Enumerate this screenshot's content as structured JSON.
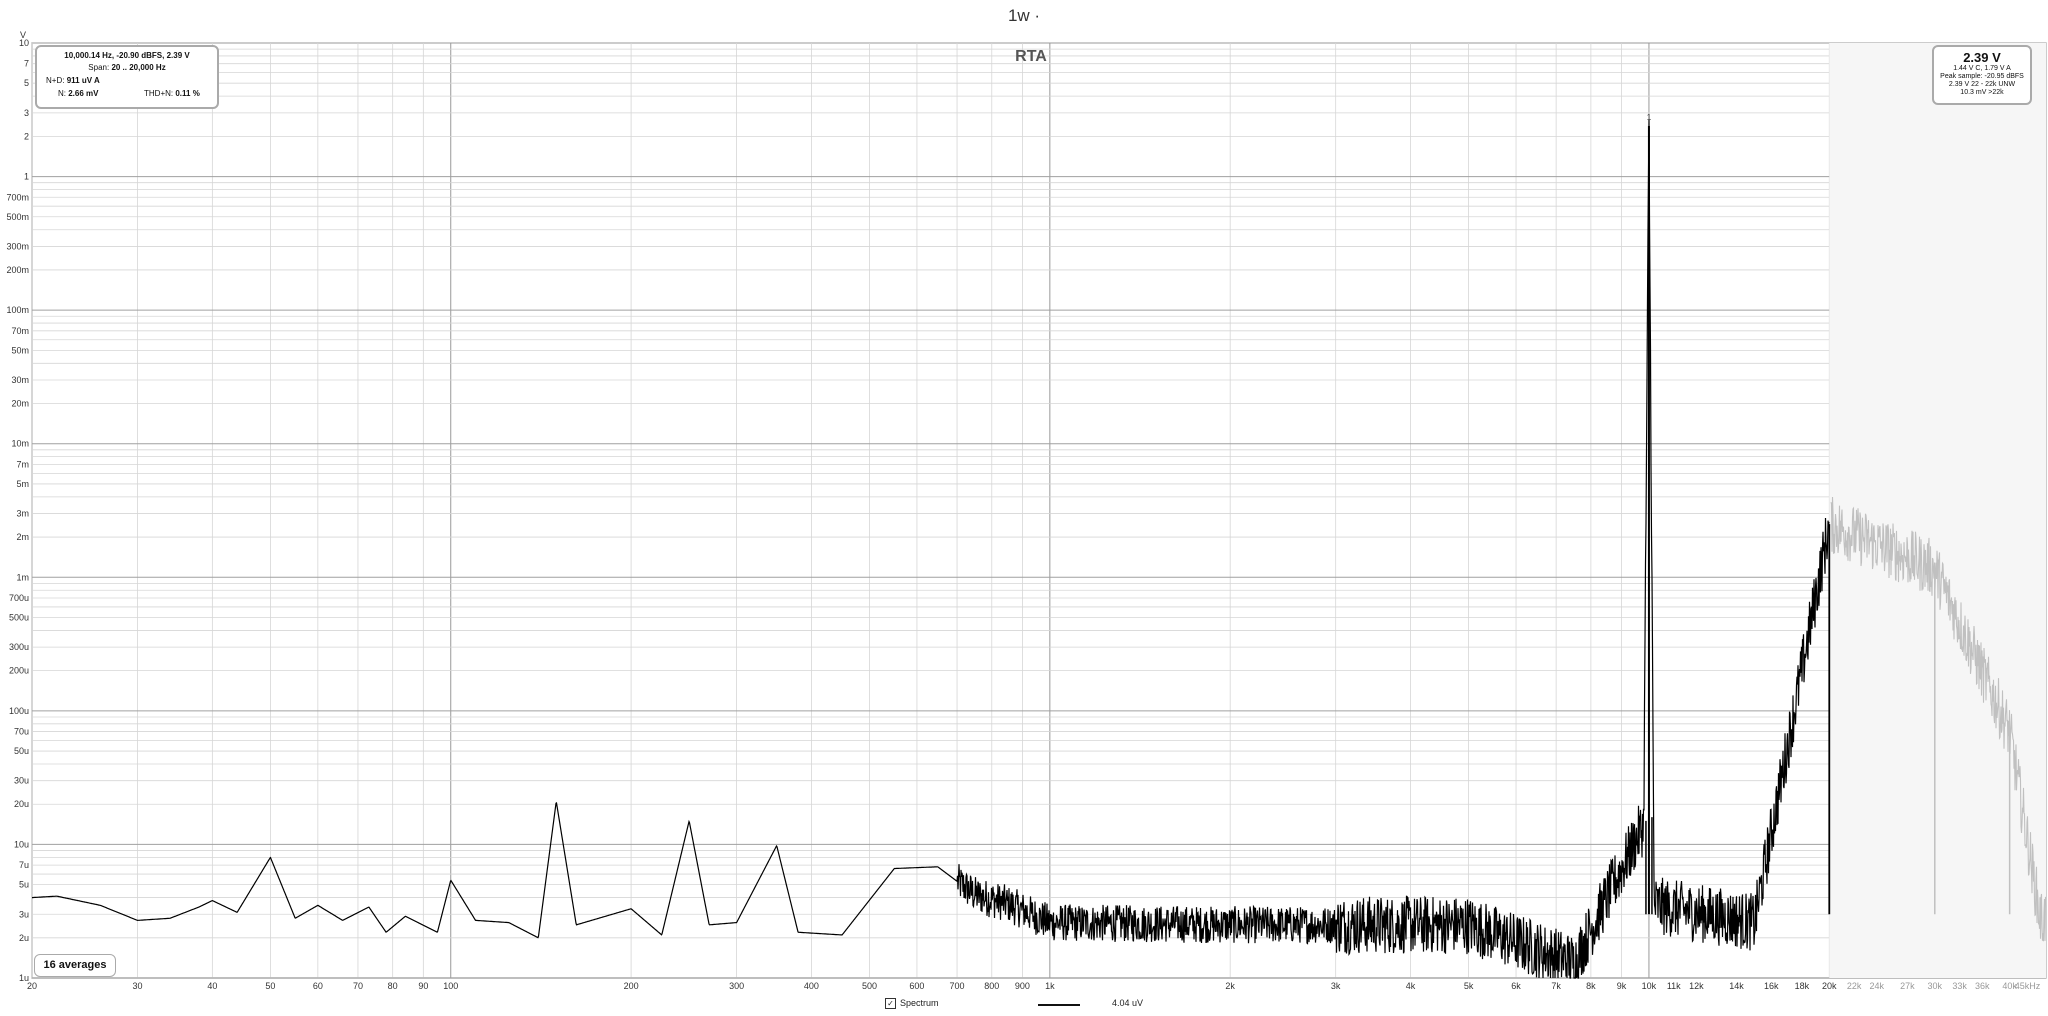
{
  "window_title": "1w ·",
  "chart_data": {
    "type": "line",
    "title": "RTA",
    "y_unit_label": "V",
    "x_scale": "log",
    "y_scale": "log",
    "xlim": [
      20,
      46000
    ],
    "ylim": [
      1e-06,
      10
    ],
    "x_ticks": [
      {
        "v": 20,
        "t": "20"
      },
      {
        "v": 30,
        "t": "30"
      },
      {
        "v": 40,
        "t": "40"
      },
      {
        "v": 50,
        "t": "50"
      },
      {
        "v": 60,
        "t": "60"
      },
      {
        "v": 70,
        "t": "70"
      },
      {
        "v": 80,
        "t": "80"
      },
      {
        "v": 90,
        "t": "90"
      },
      {
        "v": 100,
        "t": "100"
      },
      {
        "v": 200,
        "t": "200"
      },
      {
        "v": 300,
        "t": "300"
      },
      {
        "v": 400,
        "t": "400"
      },
      {
        "v": 500,
        "t": "500"
      },
      {
        "v": 600,
        "t": "600"
      },
      {
        "v": 700,
        "t": "700"
      },
      {
        "v": 800,
        "t": "800"
      },
      {
        "v": 900,
        "t": "900"
      },
      {
        "v": 1000,
        "t": "1k"
      },
      {
        "v": 2000,
        "t": "2k"
      },
      {
        "v": 3000,
        "t": "3k"
      },
      {
        "v": 4000,
        "t": "4k"
      },
      {
        "v": 5000,
        "t": "5k"
      },
      {
        "v": 6000,
        "t": "6k"
      },
      {
        "v": 7000,
        "t": "7k"
      },
      {
        "v": 8000,
        "t": "8k"
      },
      {
        "v": 9000,
        "t": "9k"
      },
      {
        "v": 10000,
        "t": "10k"
      },
      {
        "v": 11000,
        "t": "11k"
      },
      {
        "v": 12000,
        "t": "12k"
      },
      {
        "v": 14000,
        "t": "14k"
      },
      {
        "v": 16000,
        "t": "16k"
      },
      {
        "v": 18000,
        "t": "18k"
      },
      {
        "v": 20000,
        "t": "20k"
      },
      {
        "v": 22000,
        "t": "22k"
      },
      {
        "v": 24000,
        "t": "24k"
      },
      {
        "v": 27000,
        "t": "27k"
      },
      {
        "v": 30000,
        "t": "30k"
      },
      {
        "v": 33000,
        "t": "33k"
      },
      {
        "v": 36000,
        "t": "36k"
      },
      {
        "v": 40000,
        "t": "40k"
      },
      {
        "v": 45000,
        "t": "45kHz"
      }
    ],
    "y_ticks": [
      {
        "v": 10,
        "t": "10"
      },
      {
        "v": 7,
        "t": "7"
      },
      {
        "v": 5,
        "t": "5"
      },
      {
        "v": 3,
        "t": "3"
      },
      {
        "v": 2,
        "t": "2"
      },
      {
        "v": 1,
        "t": "1"
      },
      {
        "v": 0.7,
        "t": "700m"
      },
      {
        "v": 0.5,
        "t": "500m"
      },
      {
        "v": 0.3,
        "t": "300m"
      },
      {
        "v": 0.2,
        "t": "200m"
      },
      {
        "v": 0.1,
        "t": "100m"
      },
      {
        "v": 0.07,
        "t": "70m"
      },
      {
        "v": 0.05,
        "t": "50m"
      },
      {
        "v": 0.03,
        "t": "30m"
      },
      {
        "v": 0.02,
        "t": "20m"
      },
      {
        "v": 0.01,
        "t": "10m"
      },
      {
        "v": 0.007,
        "t": "7m"
      },
      {
        "v": 0.005,
        "t": "5m"
      },
      {
        "v": 0.003,
        "t": "3m"
      },
      {
        "v": 0.002,
        "t": "2m"
      },
      {
        "v": 0.001,
        "t": "1m"
      },
      {
        "v": 0.0007,
        "t": "700u"
      },
      {
        "v": 0.0005,
        "t": "500u"
      },
      {
        "v": 0.0003,
        "t": "300u"
      },
      {
        "v": 0.0002,
        "t": "200u"
      },
      {
        "v": 0.0001,
        "t": "100u"
      },
      {
        "v": 7e-05,
        "t": "70u"
      },
      {
        "v": 5e-05,
        "t": "50u"
      },
      {
        "v": 3e-05,
        "t": "30u"
      },
      {
        "v": 2e-05,
        "t": "20u"
      },
      {
        "v": 1e-05,
        "t": "10u"
      },
      {
        "v": 7e-06,
        "t": "7u"
      },
      {
        "v": 5e-06,
        "t": "5u"
      },
      {
        "v": 3e-06,
        "t": "3u"
      },
      {
        "v": 2e-06,
        "t": "2u"
      },
      {
        "v": 1e-06,
        "t": "1u"
      }
    ],
    "analysis_range_hz": [
      20,
      20000
    ],
    "series": [
      {
        "name": "Spectrum",
        "color": "#000000",
        "out_of_band_color": "#c0c0c0",
        "noise_floor_v": 2.4e-06,
        "points": [
          [
            20,
            4e-06
          ],
          [
            22,
            4.1e-06
          ],
          [
            26,
            3.5e-06
          ],
          [
            30,
            2.7e-06
          ],
          [
            34,
            2.8e-06
          ],
          [
            38,
            3.4e-06
          ],
          [
            40,
            3.8e-06
          ],
          [
            44,
            3.1e-06
          ],
          [
            50,
            8e-06
          ],
          [
            55,
            2.8e-06
          ],
          [
            60,
            3.5e-06
          ],
          [
            66,
            2.7e-06
          ],
          [
            73,
            3.4e-06
          ],
          [
            78,
            2.2e-06
          ],
          [
            84,
            2.9e-06
          ],
          [
            95,
            2.2e-06
          ],
          [
            100,
            5.4e-06
          ],
          [
            110,
            2.7e-06
          ],
          [
            125,
            2.6e-06
          ],
          [
            140,
            2e-06
          ],
          [
            150,
            2.1e-05
          ],
          [
            162,
            2.5e-06
          ],
          [
            200,
            3.3e-06
          ],
          [
            225,
            2.1e-06
          ],
          [
            250,
            1.5e-05
          ],
          [
            270,
            2.5e-06
          ],
          [
            300,
            2.6e-06
          ],
          [
            350,
            9.8e-06
          ],
          [
            380,
            2.2e-06
          ],
          [
            450,
            2.1e-06
          ],
          [
            550,
            6.6e-06
          ],
          [
            650,
            6.8e-06
          ],
          [
            750,
            4.2e-06
          ],
          [
            850,
            3.6e-06
          ],
          [
            1000,
            2.6e-06
          ],
          [
            2000,
            2.5e-06
          ],
          [
            5000,
            2.5e-06
          ],
          [
            7500,
            1.3e-06
          ],
          [
            9800,
            1.4e-05
          ],
          [
            10000,
            2.39
          ],
          [
            10200,
            3.5e-06
          ],
          [
            15000,
            2.6e-06
          ],
          [
            20000,
            0.0025
          ],
          [
            30000,
            0.00115
          ],
          [
            40000,
            7e-05
          ],
          [
            45000,
            2.8e-06
          ]
        ]
      }
    ],
    "peak_marker_label": "1",
    "legend": {
      "checkbox_label": "Spectrum",
      "value": "4.04 uV",
      "checked": true
    }
  },
  "info_box": {
    "line1": "10,000.14 Hz, -20.90 dBFS, 2.39 V",
    "span_label": "Span:",
    "span_value": "20 .. 20,000 Hz",
    "nd_label": "N+D:",
    "nd_value": "911 uV A",
    "n_label": "N:",
    "n_value": "2.66 mV",
    "thdn_label": "THD+N:",
    "thdn_value": "0.11 %"
  },
  "level_box": {
    "main": "2.39 V",
    "line1": "1.44 V C, 1.79 V A",
    "line2": "Peak sample: -20.95 dBFS",
    "line3": "2.39 V 22 - 22k UNW",
    "line4": "10.3 mV >22k"
  },
  "averages_label": "16 averages"
}
